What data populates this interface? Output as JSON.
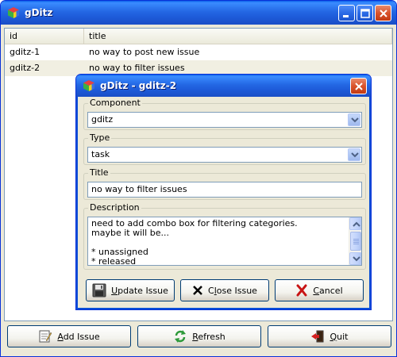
{
  "main_window": {
    "title": "gDitz",
    "columns": [
      "id",
      "title"
    ],
    "rows": [
      {
        "id": "gditz-1",
        "title": "no way to post new issue"
      },
      {
        "id": "gditz-2",
        "title": "no way to filter issues"
      }
    ],
    "buttons": {
      "add": {
        "mnemonic": "A",
        "rest": "dd Issue"
      },
      "refresh": {
        "mnemonic": "R",
        "rest": "efresh"
      },
      "quit": {
        "mnemonic": "Q",
        "rest": "uit"
      }
    }
  },
  "dialog": {
    "title": "gDitz - gditz-2",
    "component": {
      "label": "Component",
      "value": "gditz"
    },
    "type": {
      "label": "Type",
      "value": "task"
    },
    "title_field": {
      "label": "Title",
      "value": "no way to filter issues"
    },
    "description": {
      "label": "Description",
      "lines": [
        "need to add combo box for filtering categories.",
        "maybe it will be...",
        "",
        "* unassigned",
        "* released"
      ]
    },
    "buttons": {
      "update": {
        "mnemonic": "U",
        "rest": "pdate Issue"
      },
      "close": {
        "prefix": "C",
        "mnemonic": "l",
        "rest": "ose Issue"
      },
      "cancel": {
        "mnemonic": "C",
        "rest": "ancel"
      }
    }
  },
  "colors": {
    "titlebar": "#1d5ad8",
    "window_bg": "#ece9d8",
    "row_alt": "#f1efe2"
  },
  "icons": [
    "app-cube-icon",
    "minimize-icon",
    "maximize-icon",
    "close-icon",
    "notepad-icon",
    "refresh-arrows-icon",
    "exit-door-icon",
    "floppy-disk-icon",
    "x-icon",
    "red-x-icon",
    "chevron-down-icon",
    "chevron-up-icon"
  ]
}
